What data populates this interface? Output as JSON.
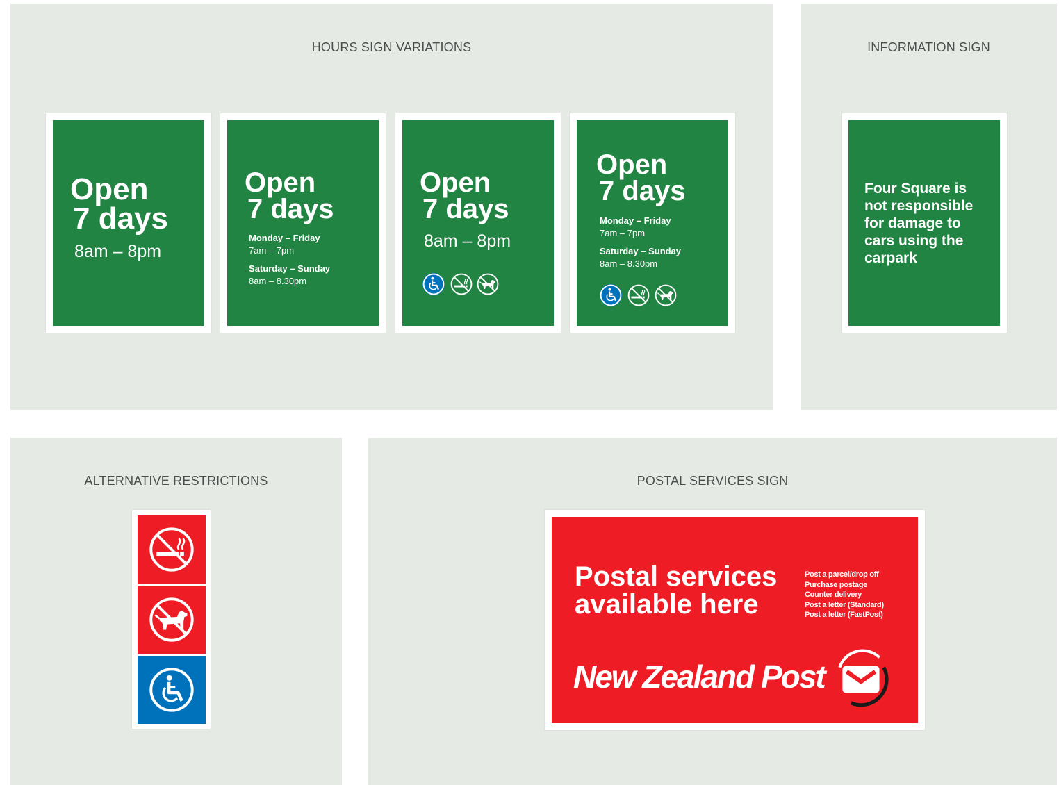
{
  "colors": {
    "panel_bg": "#e5ebe4",
    "sign_green": "#218443",
    "postal_red": "#ee1c25",
    "access_blue": "#0072bc",
    "sign_text": "#ffffff"
  },
  "hours_panel": {
    "title": "HOURS SIGN VARIATIONS",
    "signs": [
      {
        "open": "Open",
        "days": "7 days",
        "hours": "8am – 8pm"
      },
      {
        "open": "Open",
        "days": "7 days",
        "weekday_label": "Monday – Friday",
        "weekday_hours": "7am – 7pm",
        "weekend_label": "Saturday – Sunday",
        "weekend_hours": "8am – 8.30pm"
      },
      {
        "open": "Open",
        "days": "7 days",
        "hours": "8am – 8pm",
        "icons": [
          "wheelchair-access-icon",
          "no-smoking-icon",
          "no-dogs-icon"
        ]
      },
      {
        "open": "Open",
        "days": "7 days",
        "weekday_label": "Monday – Friday",
        "weekday_hours": "7am – 7pm",
        "weekend_label": "Saturday – Sunday",
        "weekend_hours": "8am – 8.30pm",
        "icons": [
          "wheelchair-access-icon",
          "no-smoking-icon",
          "no-dogs-icon"
        ]
      }
    ]
  },
  "info_panel": {
    "title": "INFORMATION SIGN",
    "text": "Four Square is not responsible for damage to cars using the carpark"
  },
  "restrictions_panel": {
    "title": "ALTERNATIVE RESTRICTIONS",
    "icons": [
      "no-smoking-icon",
      "no-dogs-icon",
      "wheelchair-access-icon"
    ]
  },
  "postal_panel": {
    "title": "POSTAL SERVICES SIGN",
    "headline_line1": "Postal services",
    "headline_line2": "available here",
    "services": [
      "Post a parcel/drop off",
      "Purchase postage",
      "Counter delivery",
      "Post a letter (Standard)",
      "Post a letter (FastPost)"
    ],
    "brand": "New Zealand Post",
    "brand_icon": "envelope-logo-icon"
  }
}
